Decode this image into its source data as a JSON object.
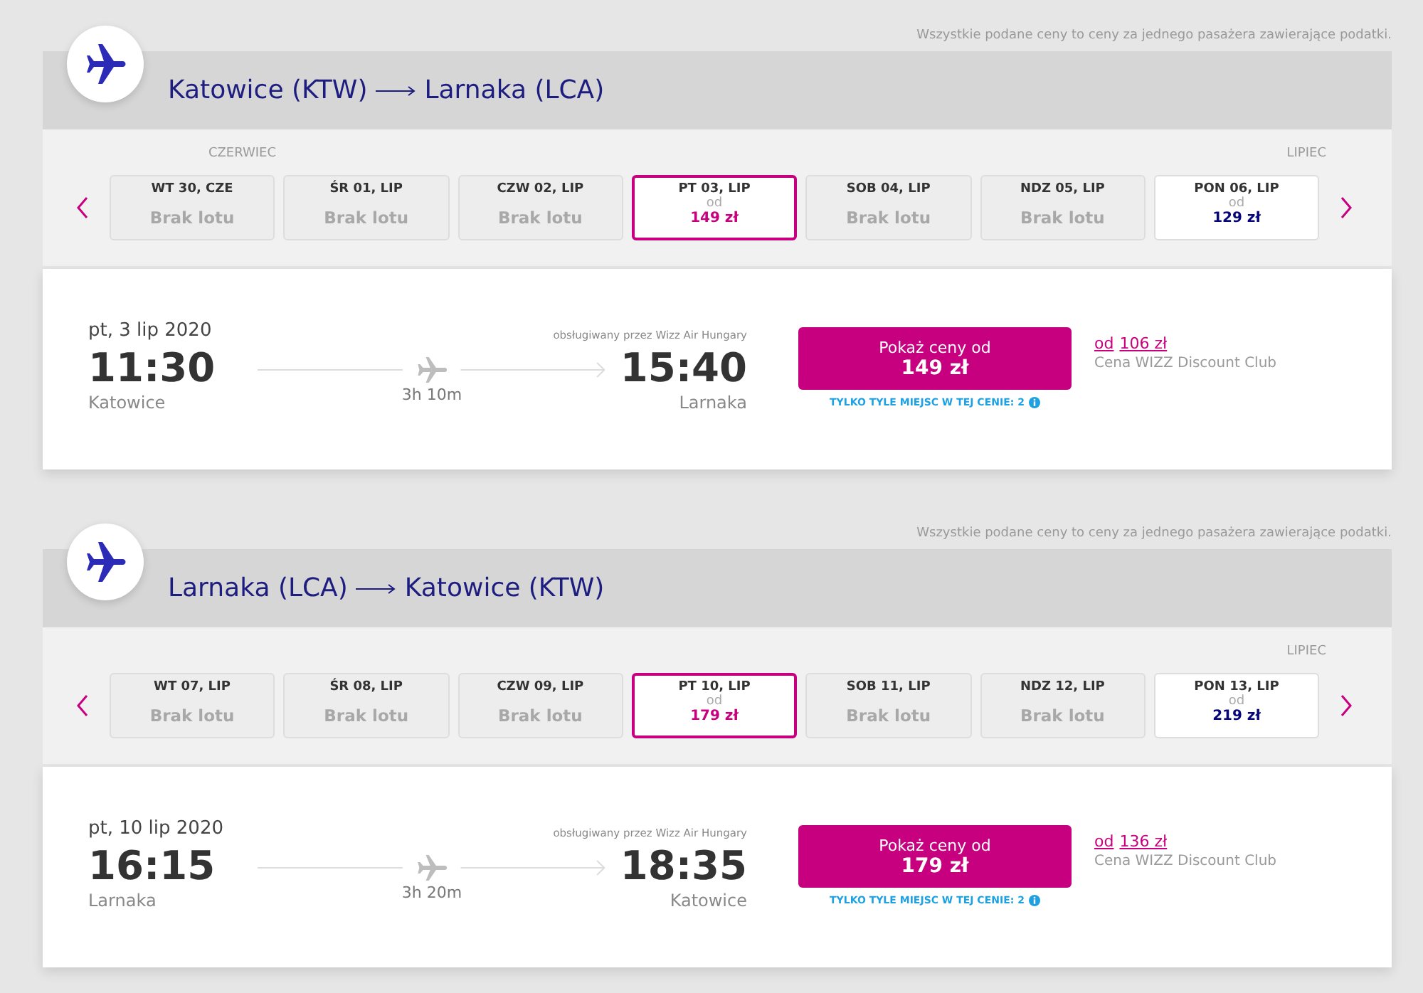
{
  "sections": [
    {
      "note": "Wszystkie podane ceny to ceny za jednego pasażera zawierające podatki.",
      "route": {
        "from": "Katowice (KTW)",
        "to": "Larnaka (LCA)"
      },
      "days": [
        {
          "label": "WT 30, CZE",
          "kind": "none",
          "status": "Brak lotu",
          "month_label": "CZERWIEC",
          "selected": false
        },
        {
          "label": "ŚR 01, LIP",
          "kind": "none",
          "status": "Brak lotu",
          "selected": false
        },
        {
          "label": "CZW 02, LIP",
          "kind": "none",
          "status": "Brak lotu",
          "selected": false
        },
        {
          "label": "PT 03, LIP",
          "kind": "price",
          "from": "od",
          "price": "149 zł",
          "selected": true
        },
        {
          "label": "SOB 04, LIP",
          "kind": "none",
          "status": "Brak lotu",
          "selected": false
        },
        {
          "label": "NDZ 05, LIP",
          "kind": "none",
          "status": "Brak lotu",
          "selected": false
        },
        {
          "label": "PON 06, LIP",
          "kind": "price",
          "from": "od",
          "price": "129 zł",
          "month_label": "LIPIEC",
          "selected": false
        }
      ],
      "flight": {
        "date": "pt, 3 lip 2020",
        "operator": "obsługiwany przez Wizz Air Hungary",
        "dep_time": "11:30",
        "dep_city": "Katowice",
        "duration": "3h 10m",
        "arr_time": "15:40",
        "arr_city": "Larnaka",
        "button_label": "Pokaż ceny od",
        "button_price": "149 zł",
        "seats_note": "TYLKO TYLE MIEJSC W TEJ CENIE: 2",
        "club_from": "od",
        "club_price": "106 zł",
        "club_label": "Cena WIZZ Discount Club"
      }
    },
    {
      "note": "Wszystkie podane ceny to ceny za jednego pasażera zawierające podatki.",
      "route": {
        "from": "Larnaka (LCA)",
        "to": "Katowice (KTW)"
      },
      "days": [
        {
          "label": "WT 07, LIP",
          "kind": "none",
          "status": "Brak lotu",
          "selected": false
        },
        {
          "label": "ŚR 08, LIP",
          "kind": "none",
          "status": "Brak lotu",
          "selected": false
        },
        {
          "label": "CZW 09, LIP",
          "kind": "none",
          "status": "Brak lotu",
          "selected": false
        },
        {
          "label": "PT 10, LIP",
          "kind": "price",
          "from": "od",
          "price": "179 zł",
          "selected": true
        },
        {
          "label": "SOB 11, LIP",
          "kind": "none",
          "status": "Brak lotu",
          "selected": false
        },
        {
          "label": "NDZ 12, LIP",
          "kind": "none",
          "status": "Brak lotu",
          "selected": false
        },
        {
          "label": "PON 13, LIP",
          "kind": "price",
          "from": "od",
          "price": "219 zł",
          "month_label": "LIPIEC",
          "selected": false
        }
      ],
      "flight": {
        "date": "pt, 10 lip 2020",
        "operator": "obsługiwany przez Wizz Air Hungary",
        "dep_time": "16:15",
        "dep_city": "Larnaka",
        "duration": "3h 20m",
        "arr_time": "18:35",
        "arr_city": "Katowice",
        "button_label": "Pokaż ceny od",
        "button_price": "179 zł",
        "seats_note": "TYLKO TYLE MIEJSC W TEJ CENIE: 2",
        "club_from": "od",
        "club_price": "136 zł",
        "club_label": "Cena WIZZ Discount Club"
      }
    }
  ]
}
